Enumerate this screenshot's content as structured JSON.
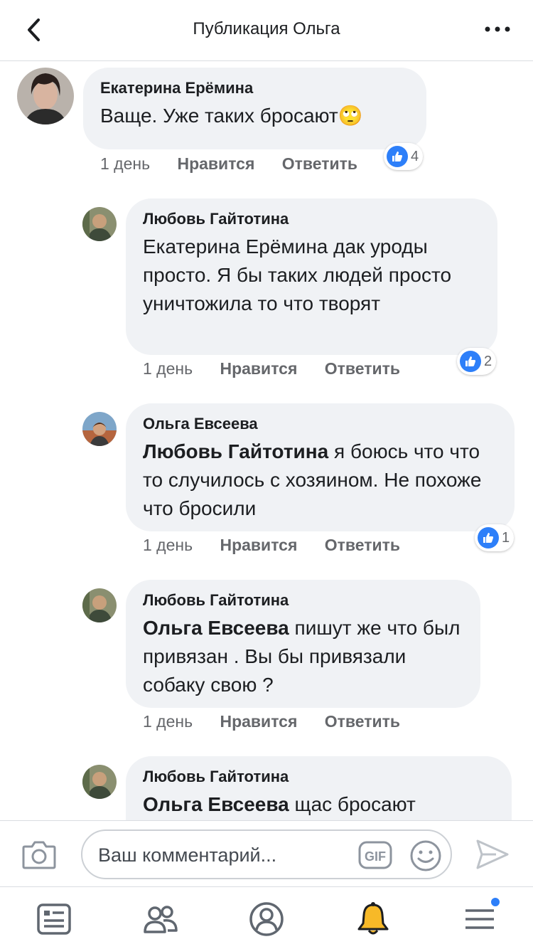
{
  "header": {
    "title": "Публикация Ольга",
    "back_icon": "chevron-left-icon",
    "more_icon": "more-dots-icon"
  },
  "comments": [
    {
      "author": "Екатерина Ерёмина",
      "mention": "",
      "text": "Ваще. Уже таких бросают",
      "emoji": "🙄",
      "time": "1 день",
      "like_label": "Нравится",
      "reply_label": "Ответить",
      "reaction_count": "4"
    },
    {
      "author": "Любовь Гайтотина",
      "mention": "",
      "text": "Екатерина Ерёмина дак  уроды просто.  Я бы таких людей просто уничтожила то что творят",
      "time": "1 день",
      "like_label": "Нравится",
      "reply_label": "Ответить",
      "reaction_count": "2"
    },
    {
      "author": "Ольга Евсеева",
      "mention": "Любовь Гайтотина",
      "text": " я боюсь что что то случилось с хозяином. Не похоже что бросили",
      "time": "1 день",
      "like_label": "Нравится",
      "reply_label": "Ответить",
      "reaction_count": "1"
    },
    {
      "author": "Любовь Гайтотина",
      "mention": "Ольга Евсеева",
      "text": " пишут  же что был привязан .  Вы бы привязали  собаку свою ?",
      "time": "1 день",
      "like_label": "Нравится",
      "reply_label": "Ответить"
    },
    {
      "author": "Любовь Гайтотина",
      "mention": "Ольга Евсеева",
      "text": " щас  бросают"
    }
  ],
  "composer": {
    "placeholder": "Ваш комментарий...",
    "gif_label": "GIF"
  },
  "tabbar": {
    "items": [
      "news-feed-icon",
      "friends-icon",
      "profile-icon",
      "notifications-bell-icon",
      "menu-icon"
    ]
  },
  "colors": {
    "accent": "#2d7ff9",
    "bubble": "#f0f2f5",
    "meta_text": "#65676b",
    "bell": "#f7b928"
  }
}
